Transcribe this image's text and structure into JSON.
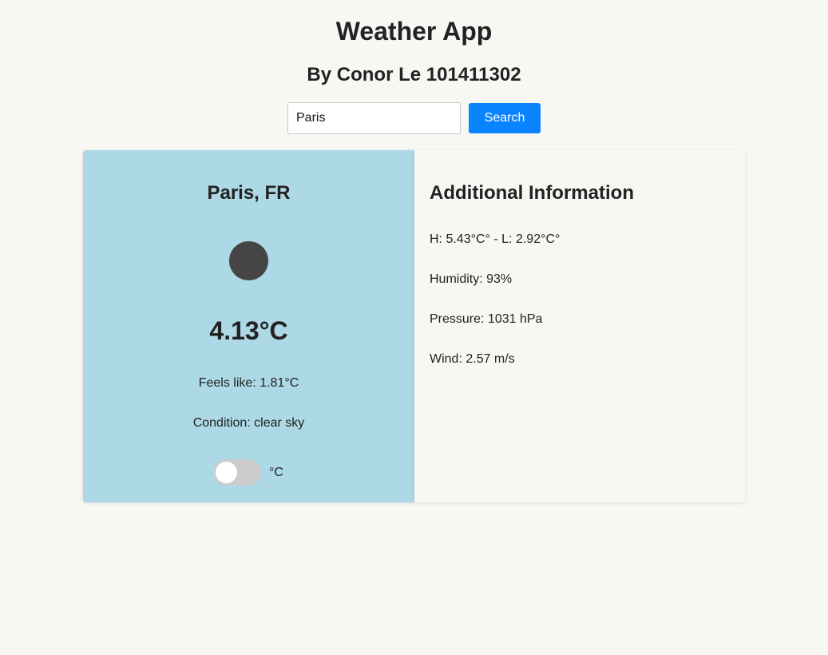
{
  "header": {
    "title": "Weather App",
    "subtitle": "By Conor Le 101411302"
  },
  "search": {
    "value": "Paris",
    "button_label": "Search",
    "button_color": "#0a84ff"
  },
  "current": {
    "location": "Paris, FR",
    "icon": "weather-condition-icon",
    "temperature": "4.13°C",
    "feels_like": "Feels like: 1.81°C",
    "condition": "Condition: clear sky",
    "card_color": "#add8e6",
    "unit_toggle_on": false,
    "unit_label": "°C"
  },
  "additional": {
    "title": "Additional Information",
    "high_low": "H: 5.43°C° - L: 2.92°C°",
    "humidity": "Humidity: 93%",
    "pressure": "Pressure: 1031 hPa",
    "wind": "Wind: 2.57 m/s"
  }
}
